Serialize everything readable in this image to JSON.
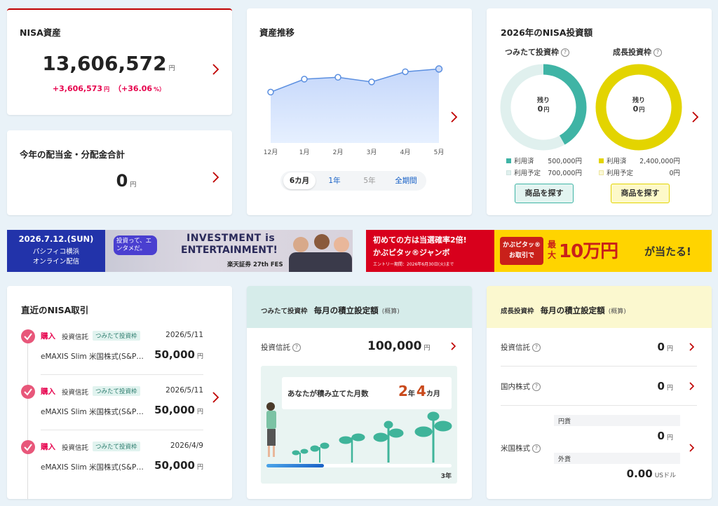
{
  "nisa_assets": {
    "title": "NISA資産",
    "value": "13,606,572",
    "unit": "円",
    "gain_prefix": "+3,606,573",
    "gain_unit": "円",
    "gain_pct": "（+36.06",
    "pct_unit": "%）"
  },
  "dividend": {
    "title": "今年の配当金・分配金合計",
    "value": "0",
    "unit": "円"
  },
  "asset_trend": {
    "title": "資産推移",
    "periods": [
      "6カ月",
      "1年",
      "5年",
      "全期間"
    ],
    "selected_period": "6カ月"
  },
  "chart_data": {
    "type": "area",
    "categories": [
      "12月",
      "1月",
      "2月",
      "3月",
      "4月",
      "5月"
    ],
    "values": [
      0.55,
      0.69,
      0.71,
      0.66,
      0.77,
      0.8
    ],
    "ylim": [
      0,
      1
    ],
    "grid": false,
    "color": "#5b8fe0"
  },
  "nisa_invest": {
    "title": "2026年のNISA投資額",
    "tsumitate": {
      "label": "つみたて投資枠",
      "remain_label": "残り",
      "remain_value": "0",
      "remain_unit": "円",
      "used_label": "利用済",
      "used_value": "500,000",
      "used_unit": "円",
      "planned_label": "利用予定",
      "planned_value": "700,000",
      "planned_unit": "円",
      "used_fraction": 0.417,
      "color": "#3fb4a5",
      "btn": "商品を探す"
    },
    "growth": {
      "label": "成長投資枠",
      "remain_label": "残り",
      "remain_value": "0",
      "remain_unit": "円",
      "used_label": "利用済",
      "used_value": "2,400,000",
      "used_unit": "円",
      "planned_label": "利用予定",
      "planned_value": "0",
      "planned_unit": "円",
      "used_fraction": 1.0,
      "color": "#e3d400",
      "btn": "商品を探す"
    }
  },
  "banner1": {
    "date": "2026.7.12.(SUN)",
    "venue": "パシフィコ横浜",
    "online": "オンライン配信",
    "bubble": "投資って、エンタメだ。",
    "title1": "INVESTMENT is",
    "title2": "ENTERTAINMENT!",
    "sub": "楽天証券 27th FES"
  },
  "banner2": {
    "line1": "初めての方は当選確率2倍!",
    "line2": "かぶピタッ®ジャンボ",
    "line3": "エントリー期間：2026年6月30日(火)まで",
    "l1": "かぶピタッ®",
    "l2": "お取引で",
    "max": "最大",
    "prize": "10万円",
    "suffix": "が当たる!"
  },
  "recent": {
    "title": "直近のNISA取引",
    "items": [
      {
        "action": "購入",
        "type": "投資信託",
        "tag": "つみたて投資枠",
        "date": "2026/5/11",
        "name": "eMAXIS Slim 米国株式(S&P…",
        "amount": "50,000",
        "unit": "円"
      },
      {
        "action": "購入",
        "type": "投資信託",
        "tag": "つみたて投資枠",
        "date": "2026/5/11",
        "name": "eMAXIS Slim 米国株式(S&P…",
        "amount": "50,000",
        "unit": "円"
      },
      {
        "action": "購入",
        "type": "投資信託",
        "tag": "つみたて投資枠",
        "date": "2026/4/9",
        "name": "eMAXIS Slim 米国株式(S&P…",
        "amount": "50,000",
        "unit": "円"
      }
    ]
  },
  "monthly_tsumitate": {
    "tag": "つみたて投資枠",
    "title": "毎月の積立設定額",
    "note": "(概算)",
    "label": "投資信託",
    "value": "100,000",
    "unit": "円",
    "months_label": "あなたが積み立てた月数",
    "years": "2",
    "years_unit": "年",
    "months": "4",
    "months_unit": "カ月",
    "progress_end": "3年",
    "progress_fraction": 0.78
  },
  "monthly_growth": {
    "tag": "成長投資枠",
    "title": "毎月の積立設定額",
    "note": "(概算)",
    "rows": [
      {
        "label": "投資信託",
        "value": "0",
        "unit": "円"
      },
      {
        "label": "国内株式",
        "value": "0",
        "unit": "円"
      }
    ],
    "us": {
      "label": "米国株式",
      "yen_label": "円貨",
      "yen_value": "0",
      "yen_unit": "円",
      "fx_label": "外貨",
      "fx_value": "0.00",
      "fx_unit": "USドル"
    }
  }
}
